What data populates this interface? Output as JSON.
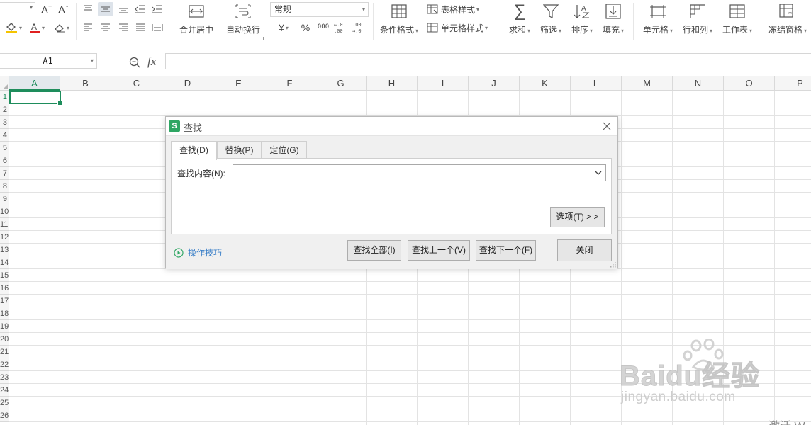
{
  "ribbon": {
    "merge_center": "合并居中",
    "wrap_text": "自动换行",
    "number_format": "常规",
    "conditional_format": "条件格式",
    "table_style": "表格样式",
    "cell_style": "单元格样式",
    "currency_symbol": "¥",
    "percent_symbol": "%",
    "thousands_symbol": "000",
    "sum": "求和",
    "filter": "筛选",
    "sort": "排序",
    "fill": "填充",
    "cell": "单元格",
    "row_col": "行和列",
    "worksheet": "工作表",
    "freeze": "冻结窗格"
  },
  "formula_bar": {
    "cell_ref": "A1",
    "fx": "fx",
    "formula": ""
  },
  "grid": {
    "columns": [
      "A",
      "B",
      "C",
      "D",
      "E",
      "F",
      "G",
      "H",
      "I",
      "J",
      "K",
      "L",
      "M",
      "N",
      "O",
      "P"
    ],
    "rows": [
      "1",
      "2",
      "3",
      "4",
      "5",
      "6",
      "7",
      "8",
      "9",
      "10",
      "11",
      "12",
      "13",
      "14",
      "15",
      "16",
      "17",
      "18",
      "19",
      "20",
      "21",
      "22",
      "23",
      "24",
      "25",
      "26"
    ],
    "active_cell": "A1"
  },
  "dialog": {
    "title": "查找",
    "tabs": [
      {
        "label": "查找(D)",
        "active": true
      },
      {
        "label": "替换(P)",
        "active": false
      },
      {
        "label": "定位(G)",
        "active": false
      }
    ],
    "find_label": "查找内容(N):",
    "find_value": "",
    "options_button": "选项(T) > >",
    "tips_link": "操作技巧",
    "find_all": "查找全部(I)",
    "find_prev": "查找上一个(V)",
    "find_next": "查找下一个(F)",
    "close": "关闭"
  },
  "watermark": {
    "brand": "Baidu经验",
    "url": "jingyan.baidu.com"
  },
  "overlay_text": "激活 W",
  "colors": {
    "accent_green": "#1e8d5c",
    "link_blue": "#3a7fc8",
    "dialog_bg": "#f0f0f0"
  }
}
